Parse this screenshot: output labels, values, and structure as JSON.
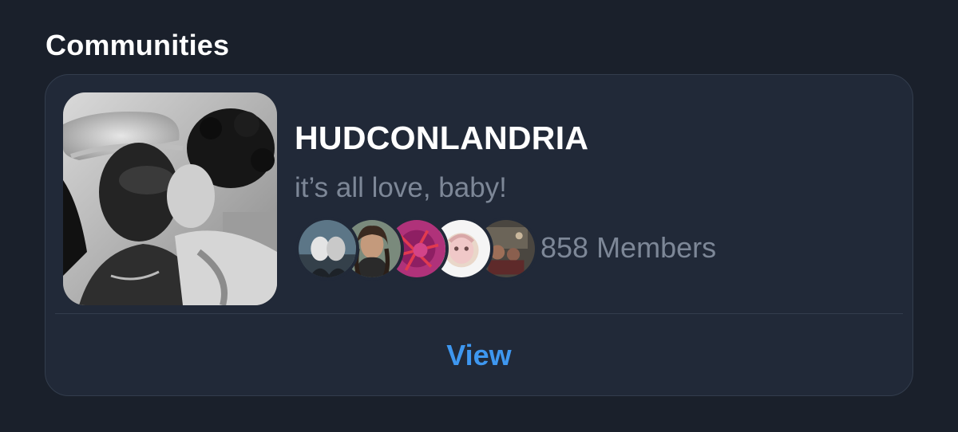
{
  "section": {
    "title": "Communities"
  },
  "community": {
    "name": "HUDCONLANDRIA",
    "tagline": "it’s all love, baby!",
    "members_label": "858 Members",
    "view_label": "View",
    "member_avatars": [
      {
        "name": "member-avatar-1"
      },
      {
        "name": "member-avatar-2"
      },
      {
        "name": "member-avatar-3"
      },
      {
        "name": "member-avatar-4"
      },
      {
        "name": "member-avatar-5"
      }
    ]
  },
  "colors": {
    "background": "#1a202b",
    "card": "#212938",
    "muted_text": "#7d8797",
    "accent": "#3e97f0"
  }
}
